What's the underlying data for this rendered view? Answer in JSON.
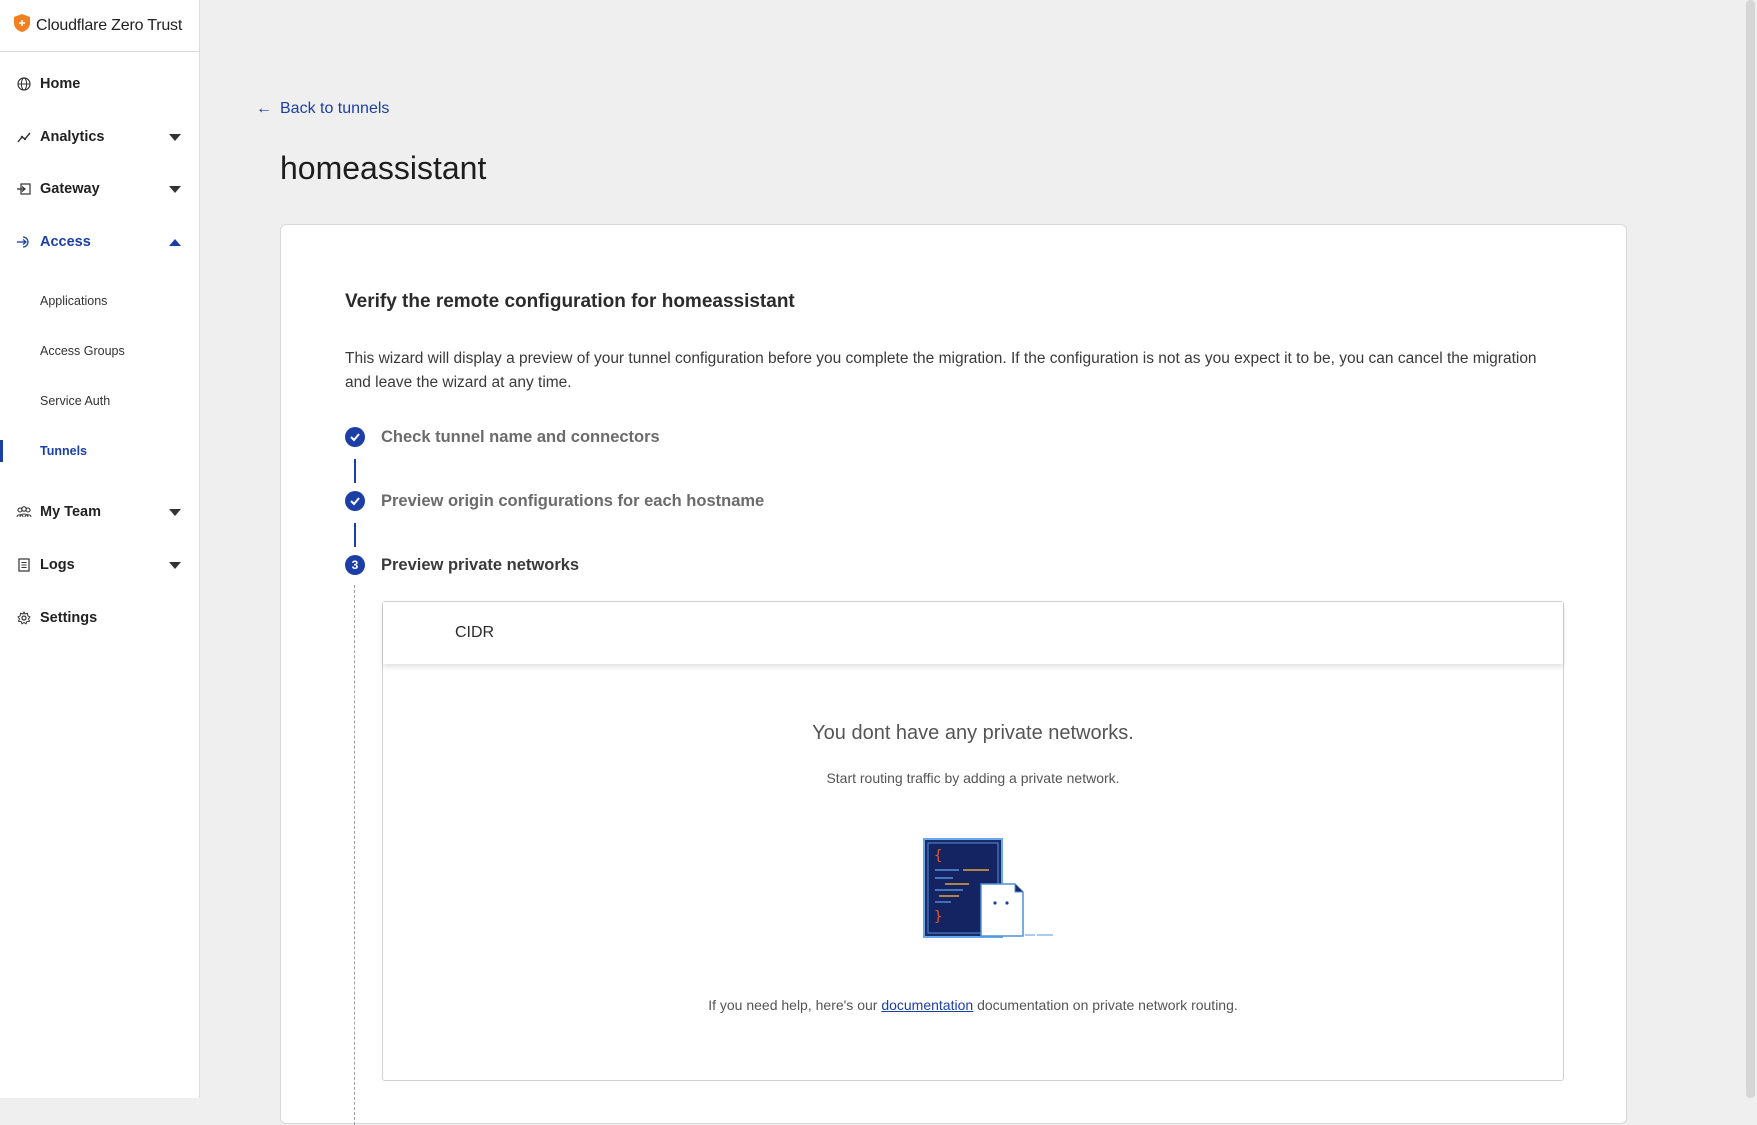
{
  "brand": {
    "name": "Cloudflare Zero Trust",
    "logo_color": "#f38020"
  },
  "sidebar": {
    "items": [
      {
        "label": "Home",
        "icon": "globe-icon",
        "caret": "none"
      },
      {
        "label": "Analytics",
        "icon": "analytics-icon",
        "caret": "down"
      },
      {
        "label": "Gateway",
        "icon": "gateway-icon",
        "caret": "down"
      },
      {
        "label": "Access",
        "icon": "access-icon",
        "caret": "up",
        "active": true
      },
      {
        "label": "My Team",
        "icon": "team-icon",
        "caret": "down"
      },
      {
        "label": "Logs",
        "icon": "logs-icon",
        "caret": "down"
      },
      {
        "label": "Settings",
        "icon": "gear-icon",
        "caret": "none"
      }
    ],
    "access_sub": [
      {
        "label": "Applications"
      },
      {
        "label": "Access Groups"
      },
      {
        "label": "Service Auth"
      },
      {
        "label": "Tunnels",
        "selected": true
      }
    ]
  },
  "main": {
    "back_label": "Back to tunnels",
    "title": "homeassistant",
    "card": {
      "heading": "Verify the remote configuration for homeassistant",
      "description": "This wizard will display a preview of your tunnel configuration before you complete the migration. If the configuration is not as you expect it to be, you can cancel the migration and leave the wizard at any time.",
      "steps": [
        {
          "label": "Check tunnel name and connectors",
          "state": "done"
        },
        {
          "label": "Preview origin configurations for each hostname",
          "state": "done"
        },
        {
          "label": "Preview private networks",
          "state": "current",
          "number": "3"
        }
      ],
      "table": {
        "column": "CIDR",
        "empty_title": "You dont have any private networks.",
        "empty_subtitle": "Start routing traffic by adding a private network.",
        "help_prefix": "If you need help, here's our",
        "help_link": "documentation",
        "help_suffix": "documentation on private network routing."
      }
    }
  },
  "colors": {
    "accent": "#1b3fa6",
    "background": "#efefef"
  }
}
